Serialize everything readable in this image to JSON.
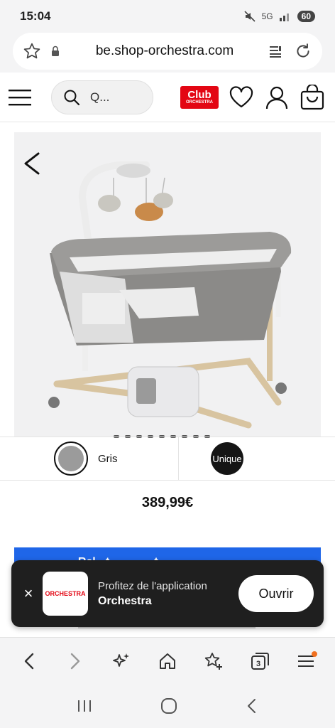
{
  "status": {
    "time": "15:04",
    "network": "5G",
    "battery": "60"
  },
  "browser": {
    "url": "be.shop-orchestra.com"
  },
  "header": {
    "search_placeholder": "Q...",
    "club_big": "Club",
    "club_small": "ORCHESTRA"
  },
  "product": {
    "image_dots_count": 9,
    "variant_color": "Gris",
    "variant_size": "Unique",
    "price": "389,99€",
    "cta_partial": "Rel · t · · · · · · t · · · · · ··· · · ··· · ···"
  },
  "app_banner": {
    "close": "×",
    "logo_text": "ORCHESTRA",
    "subtitle": "Profitez de l'application",
    "title": "Orchestra",
    "open_button": "Ouvrir"
  },
  "browser_nav": {
    "tabs_count": "3"
  },
  "colors": {
    "brand_red": "#e30613",
    "cta_blue": "#1f66e8",
    "banner_bg": "#1f1f1f"
  }
}
